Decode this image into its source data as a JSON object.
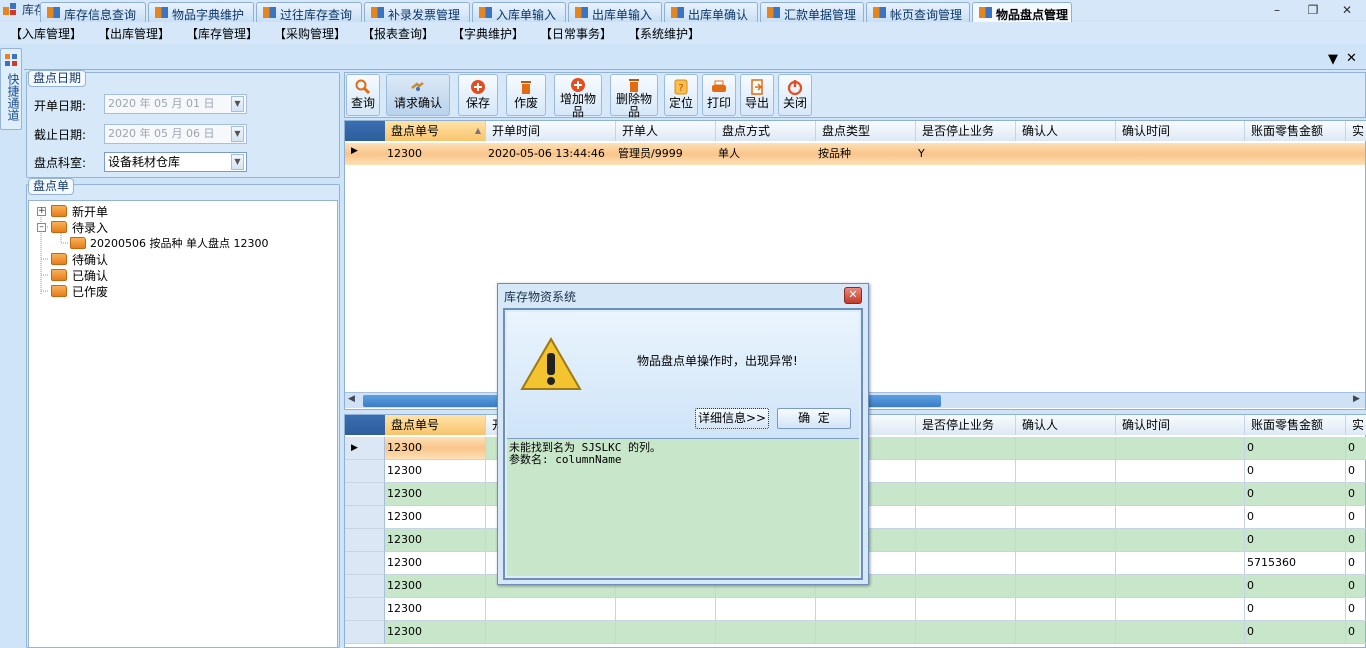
{
  "window": {
    "title": "库存物资系统"
  },
  "menu": [
    "【入库管理】",
    "【出库管理】",
    "【库存管理】",
    "【采购管理】",
    "【报表查询】",
    "【字典维护】",
    "【日常事务】",
    "【系统维护】"
  ],
  "sidebar": {
    "label": "快捷通道"
  },
  "tabs": [
    "库存信息查询",
    "物品字典维护",
    "过往库存查询",
    "补录发票管理",
    "入库单输入",
    "出库单输入",
    "出库单确认",
    "汇款单据管理",
    "帐页查询管理",
    "物品盘点管理"
  ],
  "filter": {
    "group_label": "盘点日期",
    "start_label": "开单日期:",
    "start_value": "2020 年 05 月 01 日",
    "end_label": "截止日期:",
    "end_value": "2020 年 05 月 06 日",
    "dept_label": "盘点科室:",
    "dept_value": "设备耗材仓库"
  },
  "tree": {
    "group_label": "盘点单",
    "nodes": [
      "新开单",
      "待录入",
      "20200506 按品种 单人盘点 12300",
      "待确认",
      "已确认",
      "已作废"
    ]
  },
  "toolbar": {
    "query": "查询",
    "request_confirm": "请求确认",
    "save": "保存",
    "void": "作废",
    "add_item": "增加物品",
    "delete_item": "删除物品",
    "locate": "定位",
    "print": "打印",
    "export": "导出",
    "close": "关闭"
  },
  "top_grid": {
    "columns": [
      "盘点单号",
      "开单时间",
      "开单人",
      "盘点方式",
      "盘点类型",
      "是否停止业务",
      "确认人",
      "确认时间",
      "账面零售金额",
      "实"
    ],
    "rows": [
      [
        "12300",
        "2020-05-06 13:44:46",
        "管理员/9999",
        "单人",
        "按品种",
        "Y",
        "",
        "",
        "",
        ""
      ]
    ]
  },
  "bottom_grid": {
    "columns": [
      "盘点单号",
      "开",
      "是否停止业务",
      "确认人",
      "确认时间",
      "账面零售金额",
      "实"
    ],
    "rows": [
      [
        "12300",
        "0",
        "0"
      ],
      [
        "12300",
        "0",
        "0"
      ],
      [
        "12300",
        "0",
        "0"
      ],
      [
        "12300",
        "0",
        "0"
      ],
      [
        "12300",
        "0",
        "0"
      ],
      [
        "12300",
        "5715360",
        "0"
      ],
      [
        "12300",
        "0",
        "0"
      ],
      [
        "12300",
        "0",
        "0"
      ],
      [
        "12300",
        "0",
        "0"
      ]
    ]
  },
  "dialog": {
    "title": "库存物资系统",
    "message": "物品盘点单操作时，出现异常!",
    "detail_button": "详细信息>>",
    "ok_button": "确  定",
    "detail_line1": "未能找到名为 SJSLKC 的列。",
    "detail_line2": "参数名: columnName"
  },
  "colors": {
    "accent": "#2e5e9c",
    "selected_row": "#f9c48b",
    "green_row": "#c8e6c9",
    "error_icon": "#f2c12e"
  }
}
